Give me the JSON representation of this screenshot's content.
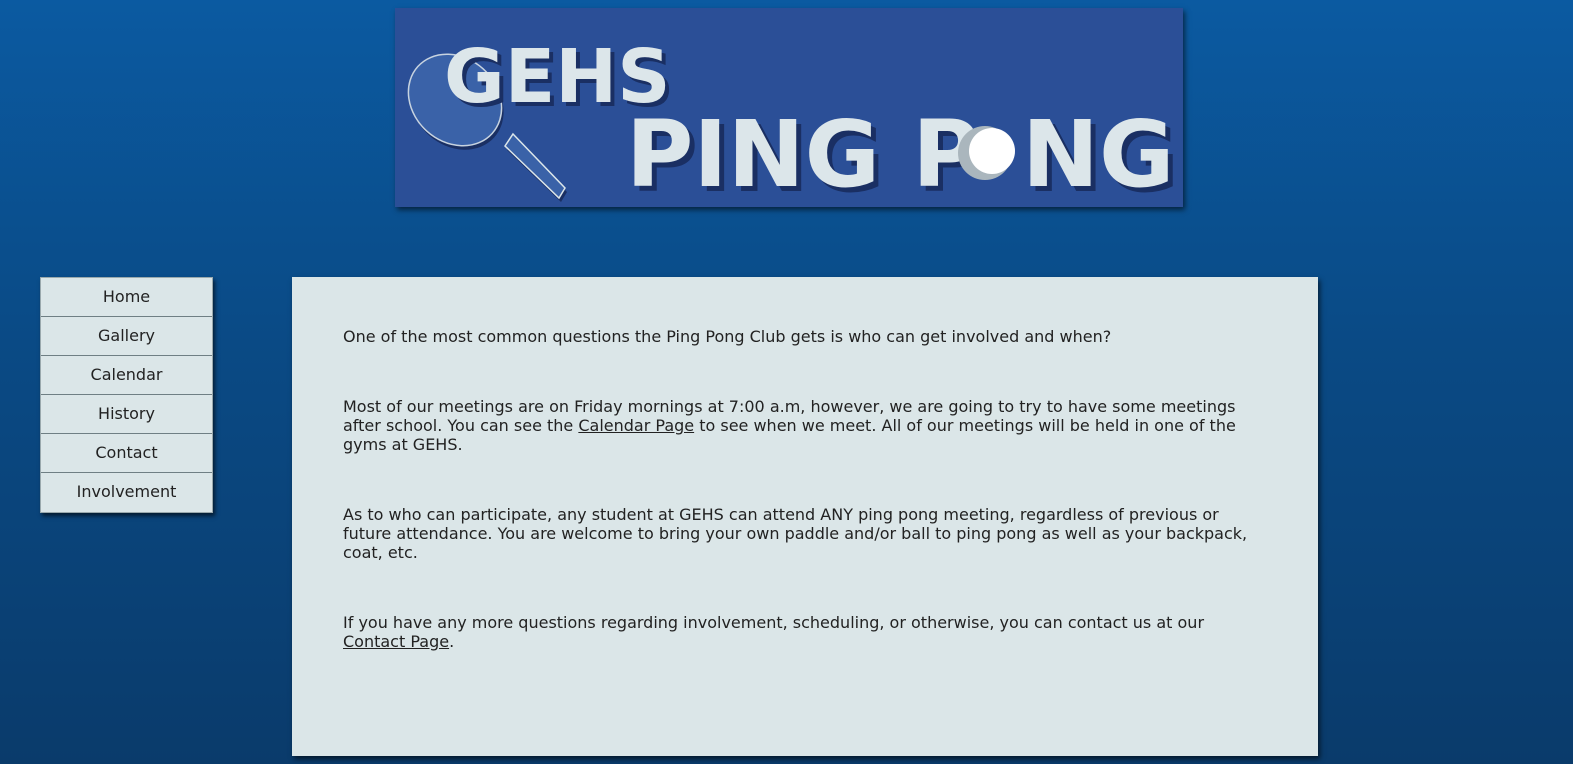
{
  "banner": {
    "line1": "GEHS",
    "line2_prefix": "PING P",
    "line2_suffix": "NG"
  },
  "nav": {
    "items": [
      {
        "label": "Home"
      },
      {
        "label": "Gallery"
      },
      {
        "label": "Calendar"
      },
      {
        "label": "History"
      },
      {
        "label": "Contact"
      },
      {
        "label": "Involvement"
      }
    ]
  },
  "content": {
    "p1": "One of the most common questions the Ping Pong Club gets is who can get involved and when?",
    "p2_before": "Most of our meetings are on Friday mornings at 7:00 a.m, however, we are going to try to have some meetings after school. You can see the ",
    "p2_link": "Calendar Page",
    "p2_after": " to see when we meet. All of our meetings will be held in one of the gyms at GEHS.",
    "p3": "As to who can participate, any student at GEHS can attend ANY ping pong meeting, regardless of previous or future attendance. You are welcome to bring your own paddle and/or ball to ping pong as well as your backpack, coat, etc.",
    "p4_before": "If you have any more questions regarding involvement, scheduling, or otherwise, you can contact us at our ",
    "p4_link": "Contact Page",
    "p4_after": "."
  },
  "colors": {
    "background_top": "#0b5aa1",
    "background_bottom": "#0a3b6b",
    "banner_bg": "#2b4f97",
    "panel_bg": "#dbe6e8",
    "banner_text": "#dce6ea"
  },
  "icons": {
    "banner_paddle": "ping-pong-paddle-icon",
    "banner_ball": "ping-pong-ball-icon"
  }
}
